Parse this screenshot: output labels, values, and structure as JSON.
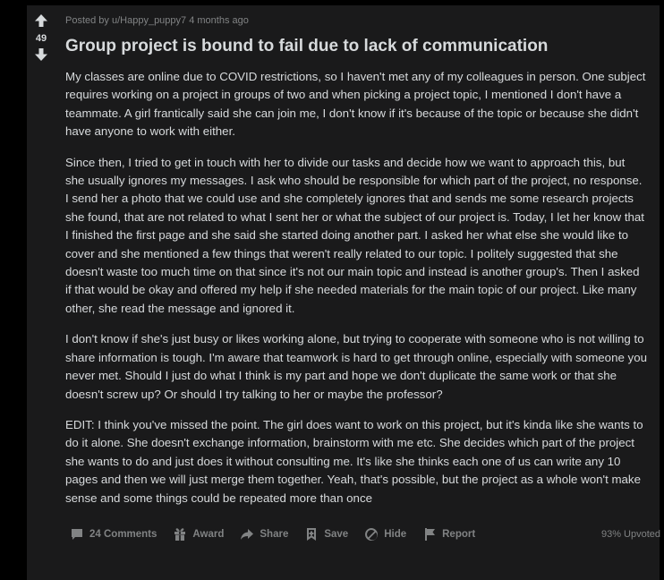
{
  "post": {
    "score": "49",
    "meta": "Posted by u/Happy_puppy7 4 months ago",
    "title": "Group project is bound to fail due to lack of communication",
    "paragraphs": [
      "My classes are online due to COVID restrictions, so I haven't met any of my colleagues in person. One subject requires working on a project in groups of two and when picking a project topic, I mentioned I don't have a teammate. A girl frantically said she can join me, I don't know if it's because of the topic or because she didn't have anyone to work with either.",
      "Since then, I tried to get in touch with her to divide our tasks and decide how we want to approach this, but she usually ignores my messages. I ask who should be responsible for which part of the project, no response. I send her a photo that we could use and she completely ignores that and sends me some research projects she found, that are not related to what I sent her or what the subject of our project is. Today, I let her know that I finished the first page and she said she started doing another part. I asked her what else she would like to cover and she mentioned a few things that weren't really related to our topic. I politely suggested that she doesn't waste too much time on that since it's not our main topic and instead is another group's. Then I asked if that would be okay and offered my help if she needed materials for the main topic of our project. Like many other, she read the message and ignored it.",
      "I don't know if she's just busy or likes working alone, but trying to cooperate with someone who is not willing to share information is tough. I'm aware that teamwork is hard to get through online, especially with someone you never met. Should I just do what I think is my part and hope we don't duplicate the same work or that she doesn't screw up? Or should I try talking to her or maybe the professor?",
      "EDIT: I think you've missed the point. The girl does want to work on this project, but it's kinda like she wants to do it alone. She doesn't exchange information, brainstorm with me etc. She decides which part of the project she wants to do and just does it without consulting me. It's like she thinks each one of us can write any 10 pages and then we will just merge them together. Yeah, that's possible, but the project as a whole won't make sense and some things could be repeated more than once"
    ],
    "actions": {
      "comments": "24 Comments",
      "award": "Award",
      "share": "Share",
      "save": "Save",
      "hide": "Hide",
      "report": "Report"
    },
    "upvoted": "93% Upvoted"
  },
  "icons": {
    "upvote": "arrow-up-icon",
    "downvote": "arrow-down-icon",
    "comments": "comment-icon",
    "award": "gift-icon",
    "share": "share-arrow-icon",
    "save": "bookmark-icon",
    "hide": "hide-circle-icon",
    "report": "flag-icon"
  },
  "colors": {
    "background": "#000000",
    "card": "#1a1a1b",
    "text": "#d7dadc",
    "muted": "#818384"
  }
}
